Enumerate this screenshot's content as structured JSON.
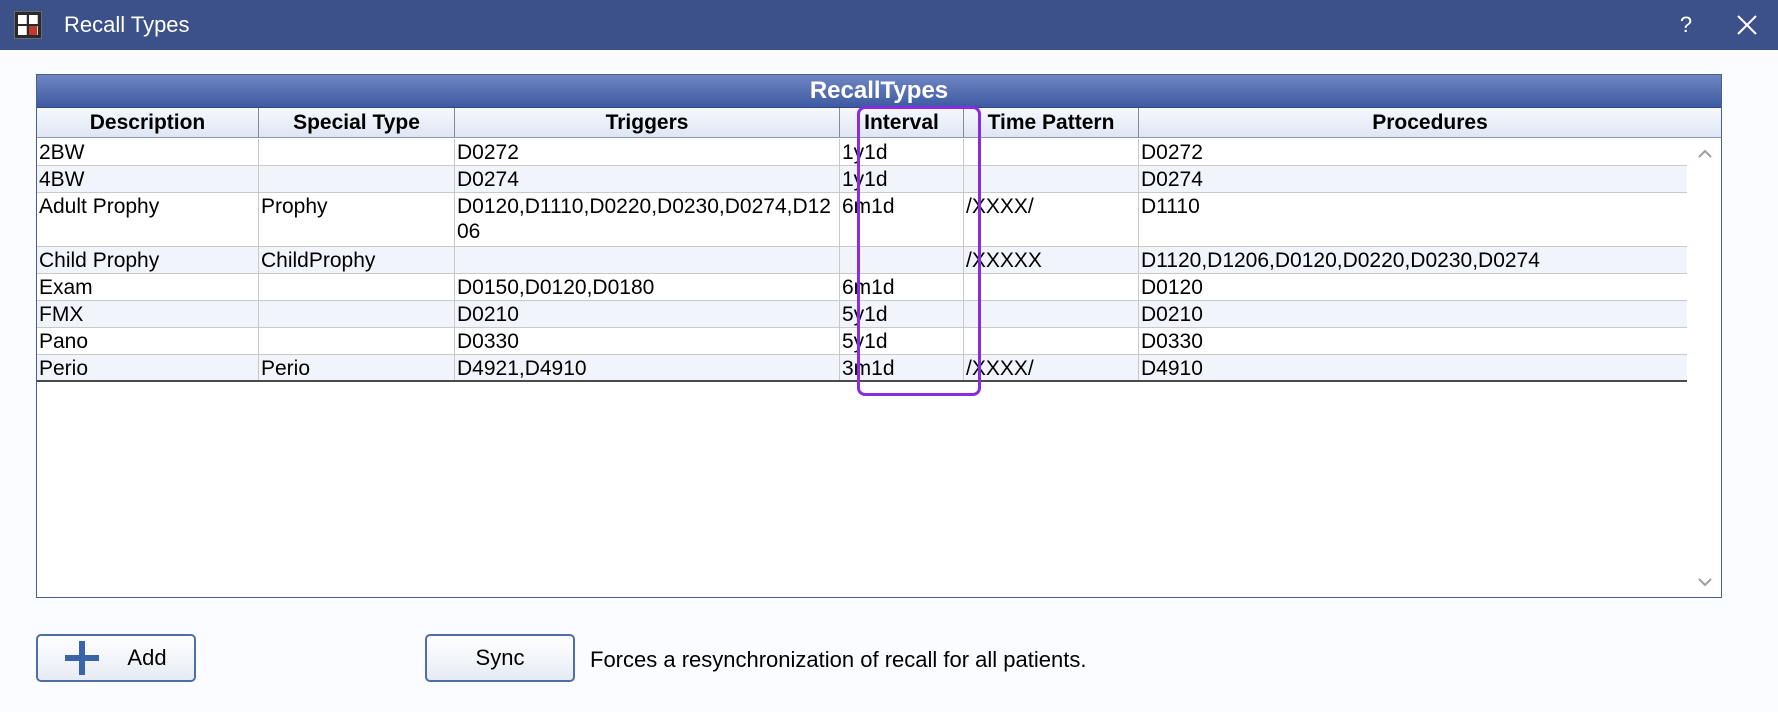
{
  "window": {
    "title": "Recall Types",
    "help_label": "?"
  },
  "grid": {
    "title": "RecallTypes",
    "columns": [
      "Description",
      "Special Type",
      "Triggers",
      "Interval",
      "Time Pattern",
      "Procedures"
    ],
    "rows": [
      {
        "description": "2BW",
        "special_type": "",
        "triggers": "D0272",
        "interval": "1y1d",
        "time_pattern": "",
        "procedures": "D0272"
      },
      {
        "description": "4BW",
        "special_type": "",
        "triggers": "D0274",
        "interval": "1y1d",
        "time_pattern": "",
        "procedures": "D0274"
      },
      {
        "description": "Adult Prophy",
        "special_type": "Prophy",
        "triggers": "D0120,D1110,D0220,D0230,D0274,D1206",
        "interval": "6m1d",
        "time_pattern": "/XXXX/",
        "procedures": "D1110"
      },
      {
        "description": "Child Prophy",
        "special_type": "ChildProphy",
        "triggers": "",
        "interval": "",
        "time_pattern": "/XXXXX",
        "procedures": "D1120,D1206,D0120,D0220,D0230,D0274"
      },
      {
        "description": "Exam",
        "special_type": "",
        "triggers": "D0150,D0120,D0180",
        "interval": "6m1d",
        "time_pattern": "",
        "procedures": "D0120"
      },
      {
        "description": "FMX",
        "special_type": "",
        "triggers": "D0210",
        "interval": "5y1d",
        "time_pattern": "",
        "procedures": "D0210"
      },
      {
        "description": "Pano",
        "special_type": "",
        "triggers": "D0330",
        "interval": "5y1d",
        "time_pattern": "",
        "procedures": "D0330"
      },
      {
        "description": "Perio",
        "special_type": "Perio",
        "triggers": "D4921,D4910",
        "interval": "3m1d",
        "time_pattern": "/XXXX/",
        "procedures": "D4910"
      }
    ]
  },
  "buttons": {
    "add_label": "Add",
    "sync_label": "Sync"
  },
  "sync_description": "Forces a resynchronization of recall for all patients.",
  "colors": {
    "titlebar": "#3c5189",
    "grid_header": "#3e5aa3",
    "highlight": "#8a2be2"
  }
}
